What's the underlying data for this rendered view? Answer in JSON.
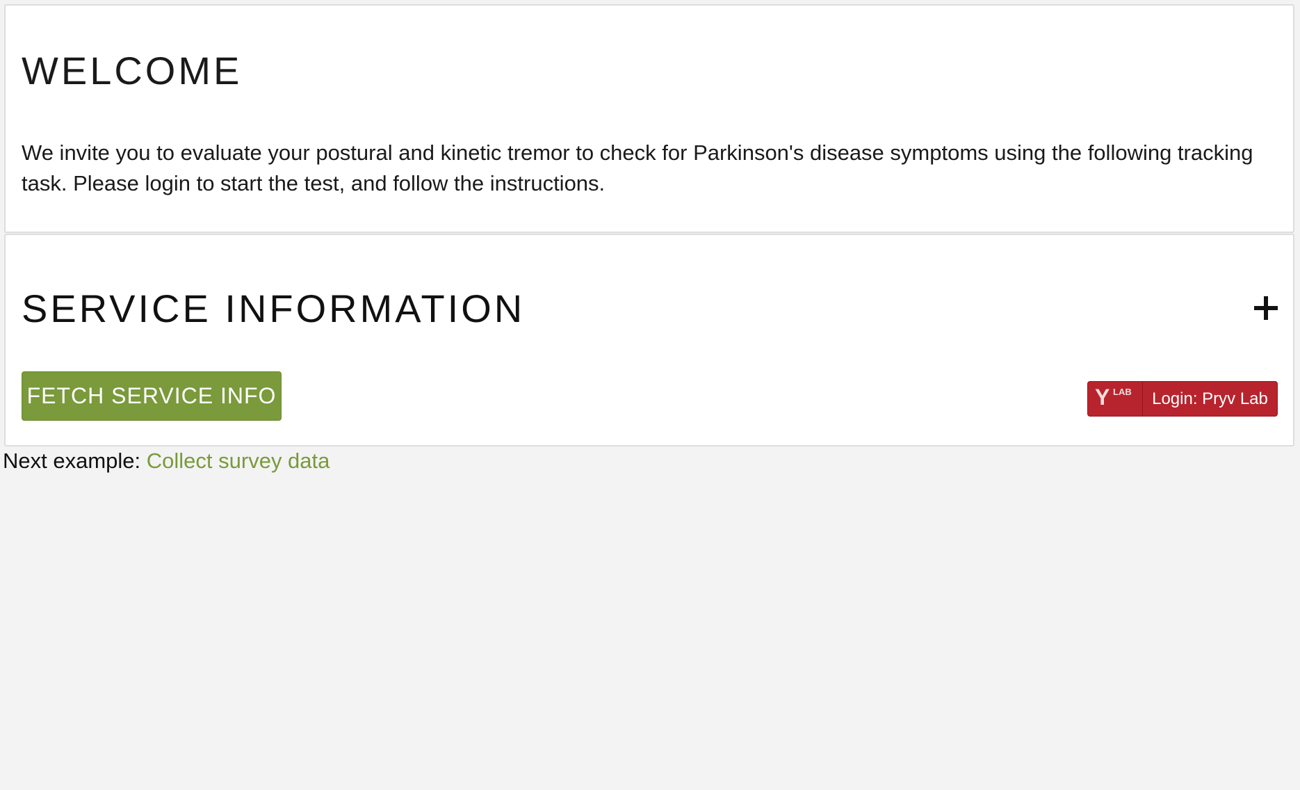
{
  "welcome": {
    "title": "WELCOME",
    "text": "We invite you to evaluate your postural and kinetic tremor to check for Parkinson's disease symptoms using the following tracking task. Please login to start the test, and follow the instructions."
  },
  "service": {
    "title": "SERVICE INFORMATION",
    "toggle_icon": "plus-icon",
    "fetch_button_label": "FETCH SERVICE INFO",
    "login": {
      "logo_letter": "Y",
      "logo_sup": "LAB",
      "label": "Login: Pryv Lab"
    }
  },
  "footer": {
    "next_example_prefix": "Next example:",
    "next_example_link": "Collect survey data"
  },
  "colors": {
    "accent_green": "#7a9a3b",
    "login_red": "#b8242d",
    "page_background": "#f3f3f3"
  }
}
